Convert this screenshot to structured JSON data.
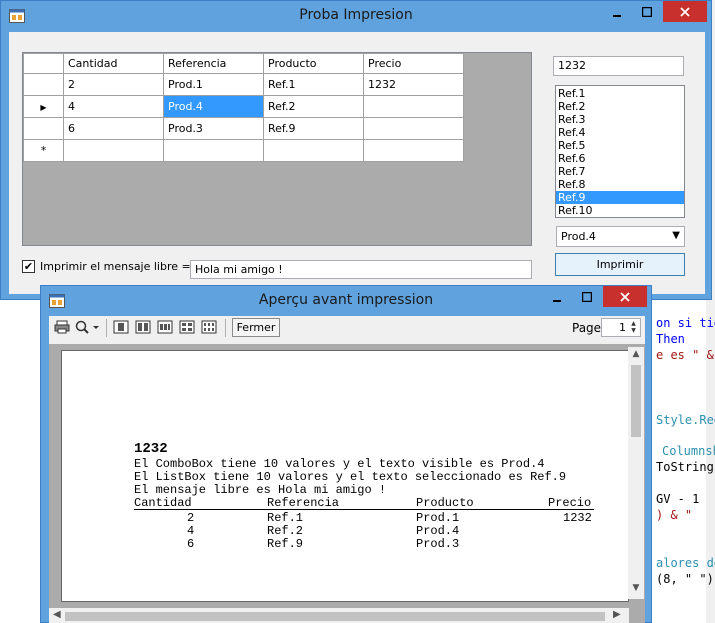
{
  "main_window": {
    "title": "Proba Impresion",
    "grid": {
      "columns": [
        "Cantidad",
        "Referencia",
        "Producto",
        "Precio"
      ],
      "rows": [
        [
          "2",
          "Prod.1",
          "Ref.1",
          "1232"
        ],
        [
          "4",
          "Prod.4",
          "Ref.2",
          ""
        ],
        [
          "6",
          "Prod.3",
          "Ref.9",
          ""
        ]
      ],
      "new_row_marker": "*",
      "current_row_marker": "▶"
    },
    "checkbox": {
      "label": "Imprimir el mensaje libre ===>",
      "checked": true,
      "mark": "✔"
    },
    "message_input": "Hola mi amigo !",
    "textbox_value": "1232",
    "listbox_items": [
      "Ref.1",
      "Ref.2",
      "Ref.3",
      "Ref.4",
      "Ref.5",
      "Ref.6",
      "Ref.7",
      "Ref.8",
      "Ref.9",
      "Ref.10"
    ],
    "listbox_selected": "Ref.9",
    "combo_value": "Prod.4",
    "print_button": "Imprimir"
  },
  "preview_window": {
    "title": "Aperçu avant impression",
    "close_button": "Fermer",
    "page_label": "Page",
    "page_value": "1",
    "document": {
      "heading": "1232",
      "line1": "El ComboBox tiene 10 valores y el texto visible es Prod.4",
      "line2": "El ListBox tiene 10 valores y el texto seleccionado es Ref.9",
      "line3": "El mensaje libre es Hola mi amigo !",
      "table_header": [
        "Cantidad",
        "Referencia",
        "Producto",
        "Precio"
      ],
      "table_rows": [
        [
          "2",
          "Ref.1",
          "Prod.1",
          "1232"
        ],
        [
          "4",
          "Ref.2",
          "Prod.4",
          ""
        ],
        [
          "6",
          "Ref.9",
          "Prod.3",
          ""
        ]
      ]
    }
  },
  "background_code": {
    "l1": "on si tie",
    "l2": "Then",
    "l3": "e es \" &",
    "l4": "Style.Reg",
    "l5": "Columnsh",
    "l6": "ToString,",
    "l7": "GV - 1",
    "l8": ") & \"",
    "l9": "alores de",
    "l10": "(8, \" \")"
  },
  "colors": {
    "titlebar": "#5fa2dd",
    "close_button": "#c7302c",
    "selection": "#3399ff",
    "grid_background": "#ababab"
  }
}
